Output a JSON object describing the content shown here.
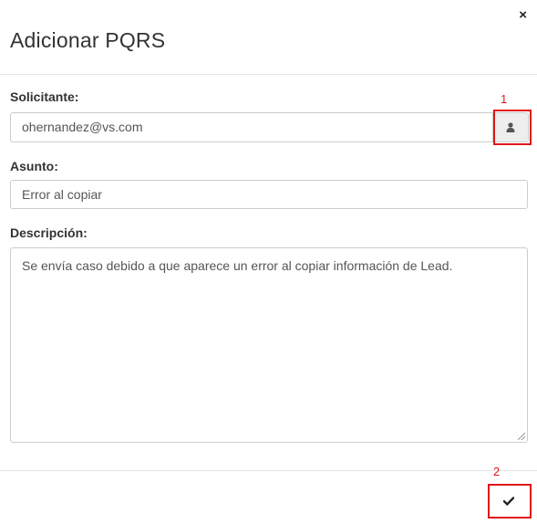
{
  "modal": {
    "title": "Adicionar PQRS",
    "close_glyph": "×"
  },
  "form": {
    "solicitante": {
      "label": "Solicitante:",
      "value": "ohernandez@vs.com",
      "button_icon": "user-icon"
    },
    "asunto": {
      "label": "Asunto:",
      "value": "Error al copiar"
    },
    "descripcion": {
      "label": "Descripción:",
      "value": "Se envía caso debido a que aparece un error al copiar información de Lead."
    }
  },
  "footer": {
    "save_icon": "checkmark-icon"
  },
  "annotations": {
    "marker_1": "1",
    "marker_2": "2",
    "highlight_color": "#e0161b"
  }
}
